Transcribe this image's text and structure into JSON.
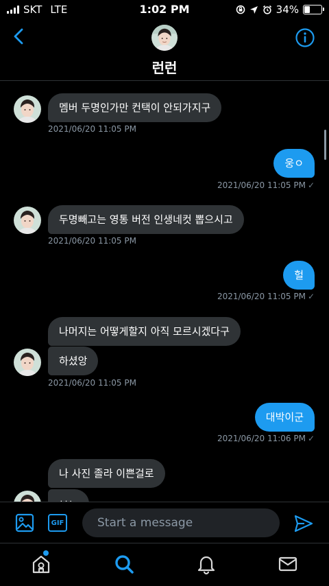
{
  "status_bar": {
    "carrier": "SKT",
    "network": "LTE",
    "time": "1:02 PM",
    "battery": "34%",
    "battery_level": 0.34,
    "icons": [
      "signal-icon",
      "screen-lock-icon",
      "location-icon",
      "alarm-icon",
      "battery-icon"
    ]
  },
  "header": {
    "name": "런런",
    "back_icon": "chevron-left-icon",
    "info_icon": "info-icon"
  },
  "messages": [
    {
      "direction": "in",
      "text": "멤버 두명인가만 컨택이 안되가지구",
      "timestamp": "2021/06/20 11:05 PM"
    },
    {
      "direction": "out",
      "text": "웅ㅇ",
      "timestamp": "2021/06/20 11:05 PM"
    },
    {
      "direction": "in",
      "text": "두명빼고는 영통 버전 인생네컷 뽑으시고",
      "timestamp": "2021/06/20 11:05 PM"
    },
    {
      "direction": "out",
      "text": "헐",
      "timestamp": "2021/06/20 11:05 PM"
    },
    {
      "direction": "in",
      "text": "나머지는 어떻게할지 아직 모르시겠다구",
      "timestamp": ""
    },
    {
      "direction": "in",
      "text": "하셨앙",
      "timestamp": "2021/06/20 11:05 PM"
    },
    {
      "direction": "out",
      "text": "대박이군",
      "timestamp": "2021/06/20 11:06 PM"
    },
    {
      "direction": "in",
      "text": "나 사진 졸라 이쁜걸로",
      "timestamp": ""
    },
    {
      "direction": "in",
      "text": "ㅂㄴ",
      "timestamp": ""
    }
  ],
  "composer": {
    "placeholder": "Start a message",
    "gif_label": "GIF",
    "icons": [
      "image-icon",
      "gif-icon",
      "send-icon"
    ]
  },
  "tabbar": {
    "tabs": [
      "home",
      "search",
      "notifications",
      "messages"
    ],
    "active": "search"
  },
  "colors": {
    "accent": "#1d9bf0",
    "bubble_in": "#2f3336",
    "background": "#000000",
    "timestamp": "#8b98a5"
  }
}
